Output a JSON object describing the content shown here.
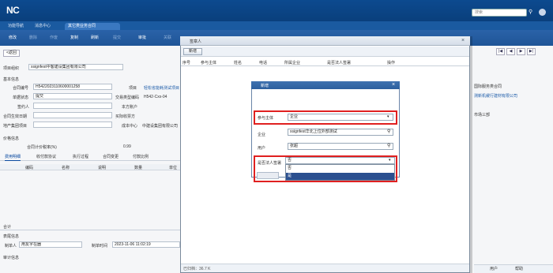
{
  "header": {
    "logo": "NC",
    "search_placeholder": "搜索"
  },
  "nav_tabs": [
    "功能导航",
    "消息中心",
    "其它类业务合同"
  ],
  "toolbar": {
    "buttons": [
      "修改",
      "删除",
      "作废",
      "复制",
      "刷新",
      "提交",
      "审批",
      "关联"
    ]
  },
  "back_label": "<返回",
  "right_nav": [
    "|◀",
    "◀",
    "▶",
    "▶|"
  ],
  "form": {
    "org_label": "项目组织",
    "org_value": "xsignfest中客建设集团有限公司",
    "section_basic": "基本信息",
    "contract_no_label": "合同编号",
    "contract_no": "H5422023110600001258",
    "project_label": "项目",
    "project_value": "轻松省能耗测试项目",
    "doc_status_label": "单据状态",
    "doc_status": "提交",
    "type_label": "交易类型编码",
    "type_value": "H542-Cxx-04",
    "sign_label": "签约人",
    "own_account_label": "本方账户",
    "effective_label": "合同生效日期",
    "invoice_label": "买际收票方",
    "company_label": "地产集团项目",
    "cost_center_label": "成本中心",
    "cost_center_value": "中建设集团有限公司",
    "right_field_1": "国际服务类合同",
    "right_field_2": "测新机缓行建材有限公司",
    "right_field_3": "市场三部",
    "section_price": "价格信息",
    "tax_label": "合同计价税率(%)",
    "tax_value": "0.99"
  },
  "sub_tabs": [
    "费用明细",
    "收付款协议",
    "执行过程",
    "合同变更",
    "付款比例"
  ],
  "grid_headers": [
    "编码",
    "名称",
    "说明",
    "数量",
    "单位"
  ],
  "total_label": "合计",
  "footer": {
    "section_label": "表尾信息",
    "creator_label": "制单人",
    "creator": "用友字在器",
    "created_label": "制单时间",
    "created_at": "2023-11-06 11:02:19",
    "audit_label": "审计信息"
  },
  "dialog1": {
    "title": "签章人",
    "add_button": "新增",
    "columns": [
      "序号",
      "参与主体",
      "姓名",
      "电话",
      "所属企业",
      "是否法人签署",
      "操作"
    ],
    "footer": "已归档：36.7 K"
  },
  "dialog2": {
    "title": "新增",
    "party_label": "参与主体",
    "party_value": "企业",
    "company_label": "企业",
    "company_value": "xsignfest华北上位外部测试",
    "user_label": "用户",
    "user_value": "张超",
    "legal_label": "是否法人签署",
    "legal_value": "否",
    "legal_options": [
      "否",
      "是"
    ]
  },
  "status_bar": [
    "用户",
    "帮助"
  ]
}
